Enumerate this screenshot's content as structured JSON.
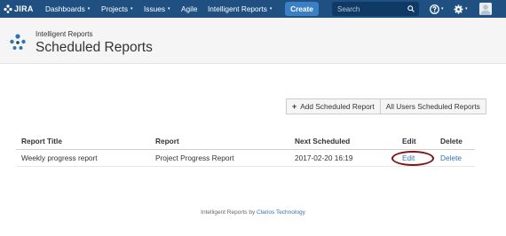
{
  "topbar": {
    "logo_text": "JIRA",
    "nav": [
      {
        "label": "Dashboards",
        "caret": "▾"
      },
      {
        "label": "Projects",
        "caret": "▾"
      },
      {
        "label": "Issues",
        "caret": "▾"
      },
      {
        "label": "Agile",
        "caret": ""
      },
      {
        "label": "Intelligent Reports",
        "caret": "▾"
      }
    ],
    "create_label": "Create",
    "search_placeholder": "Search",
    "help_caret": "▾",
    "settings_caret": "▾",
    "colors": {
      "bar": "#205081",
      "create": "#3b7fc4",
      "search_bg": "#0f3a66"
    }
  },
  "header": {
    "subtitle": "Intelligent Reports",
    "title": "Scheduled Reports"
  },
  "actions": {
    "add_label": "Add Scheduled Report",
    "all_users_label": "All Users Scheduled Reports"
  },
  "table": {
    "columns": [
      "Report Title",
      "Report",
      "Next Scheduled",
      "Edit",
      "Delete"
    ],
    "rows": [
      {
        "title": "Weekly progress report",
        "report": "Project Progress Report",
        "next_scheduled": "2017-02-20 16:19",
        "edit": "Edit",
        "delete": "Delete"
      }
    ]
  },
  "footer": {
    "text": "Intelligent Reports by",
    "link": "Clarios Technology"
  },
  "icons": {
    "logo": "jira-logo-icon",
    "search": "search-icon",
    "help": "help-icon",
    "settings": "gear-icon",
    "avatar": "avatar",
    "page": "intelligent-reports-logo-icon"
  },
  "accent_colors": {
    "link": "#3572b0",
    "highlight": "#7f1616"
  }
}
